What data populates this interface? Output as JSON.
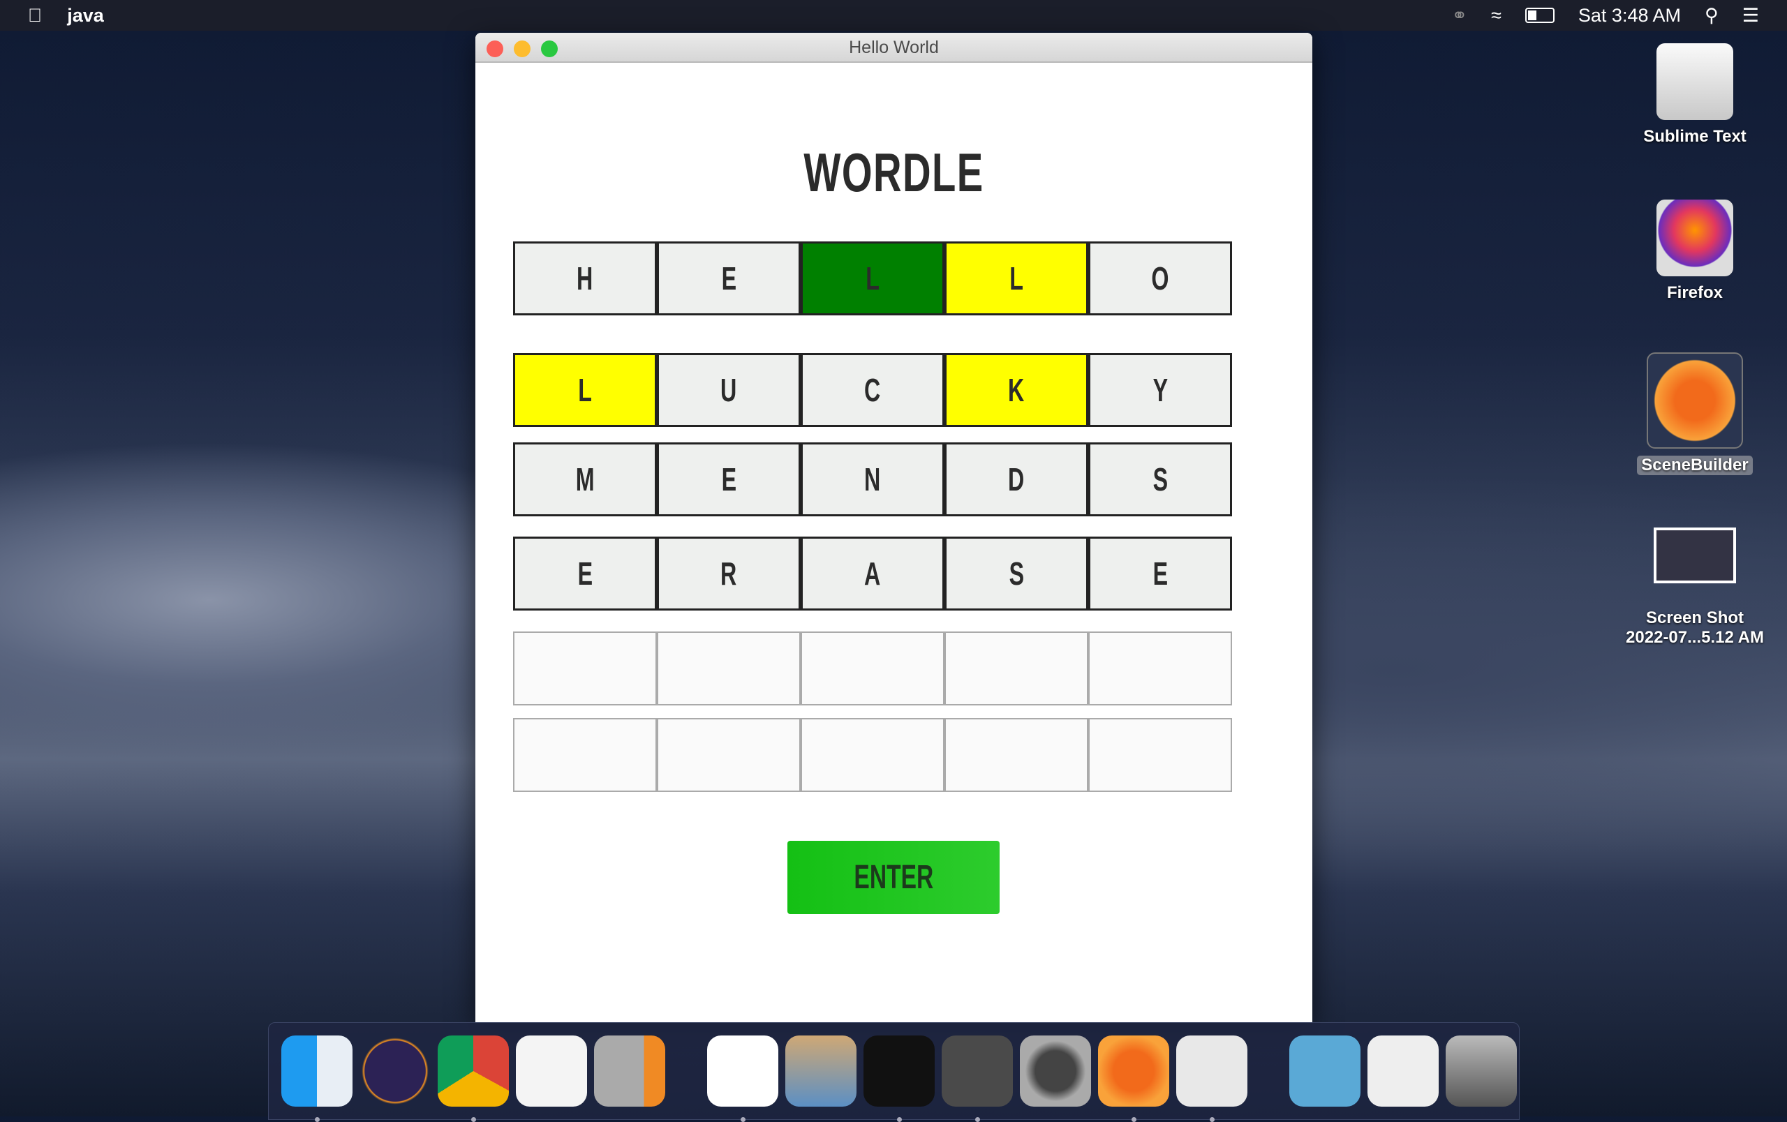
{
  "menubar": {
    "app_name": "java",
    "clock": "Sat 3:48 AM",
    "icons": [
      "apple-icon",
      "creative-cloud-icon",
      "wifi-icon",
      "battery-icon",
      "spotlight-icon",
      "notification-center-icon"
    ]
  },
  "window": {
    "title": "Hello World"
  },
  "game": {
    "title": "WORDLE",
    "enter_label": "ENTER",
    "colors": {
      "green": "#008000",
      "yellow": "#ffff00",
      "gray": "#eef0ee"
    },
    "rows": [
      [
        {
          "l": "H",
          "s": "gray"
        },
        {
          "l": "E",
          "s": "gray"
        },
        {
          "l": "L",
          "s": "green"
        },
        {
          "l": "L",
          "s": "yellow"
        },
        {
          "l": "O",
          "s": "gray"
        }
      ],
      [
        {
          "l": "L",
          "s": "yellow"
        },
        {
          "l": "U",
          "s": "gray"
        },
        {
          "l": "C",
          "s": "gray"
        },
        {
          "l": "K",
          "s": "yellow"
        },
        {
          "l": "Y",
          "s": "gray"
        }
      ],
      [
        {
          "l": "M",
          "s": "gray"
        },
        {
          "l": "E",
          "s": "gray"
        },
        {
          "l": "N",
          "s": "gray"
        },
        {
          "l": "D",
          "s": "gray"
        },
        {
          "l": "S",
          "s": "gray"
        }
      ],
      [
        {
          "l": "E",
          "s": "gray"
        },
        {
          "l": "R",
          "s": "gray"
        },
        {
          "l": "A",
          "s": "gray"
        },
        {
          "l": "S",
          "s": "gray"
        },
        {
          "l": "E",
          "s": "gray"
        }
      ],
      [],
      []
    ]
  },
  "desktop": [
    "Sublime Text",
    "Firefox",
    "SceneBuilder",
    "Screen Shot\n2022-07...5.12 AM"
  ],
  "dock": [
    "finder",
    "eclipse",
    "chrome",
    "textedit",
    "calculator",
    "|",
    "vscode",
    "preview",
    "terminal",
    "sublime-text",
    "system-preferences",
    "scenebuilder",
    "java-launcher",
    "|",
    "applications-folder",
    "recent-window",
    "trash"
  ]
}
